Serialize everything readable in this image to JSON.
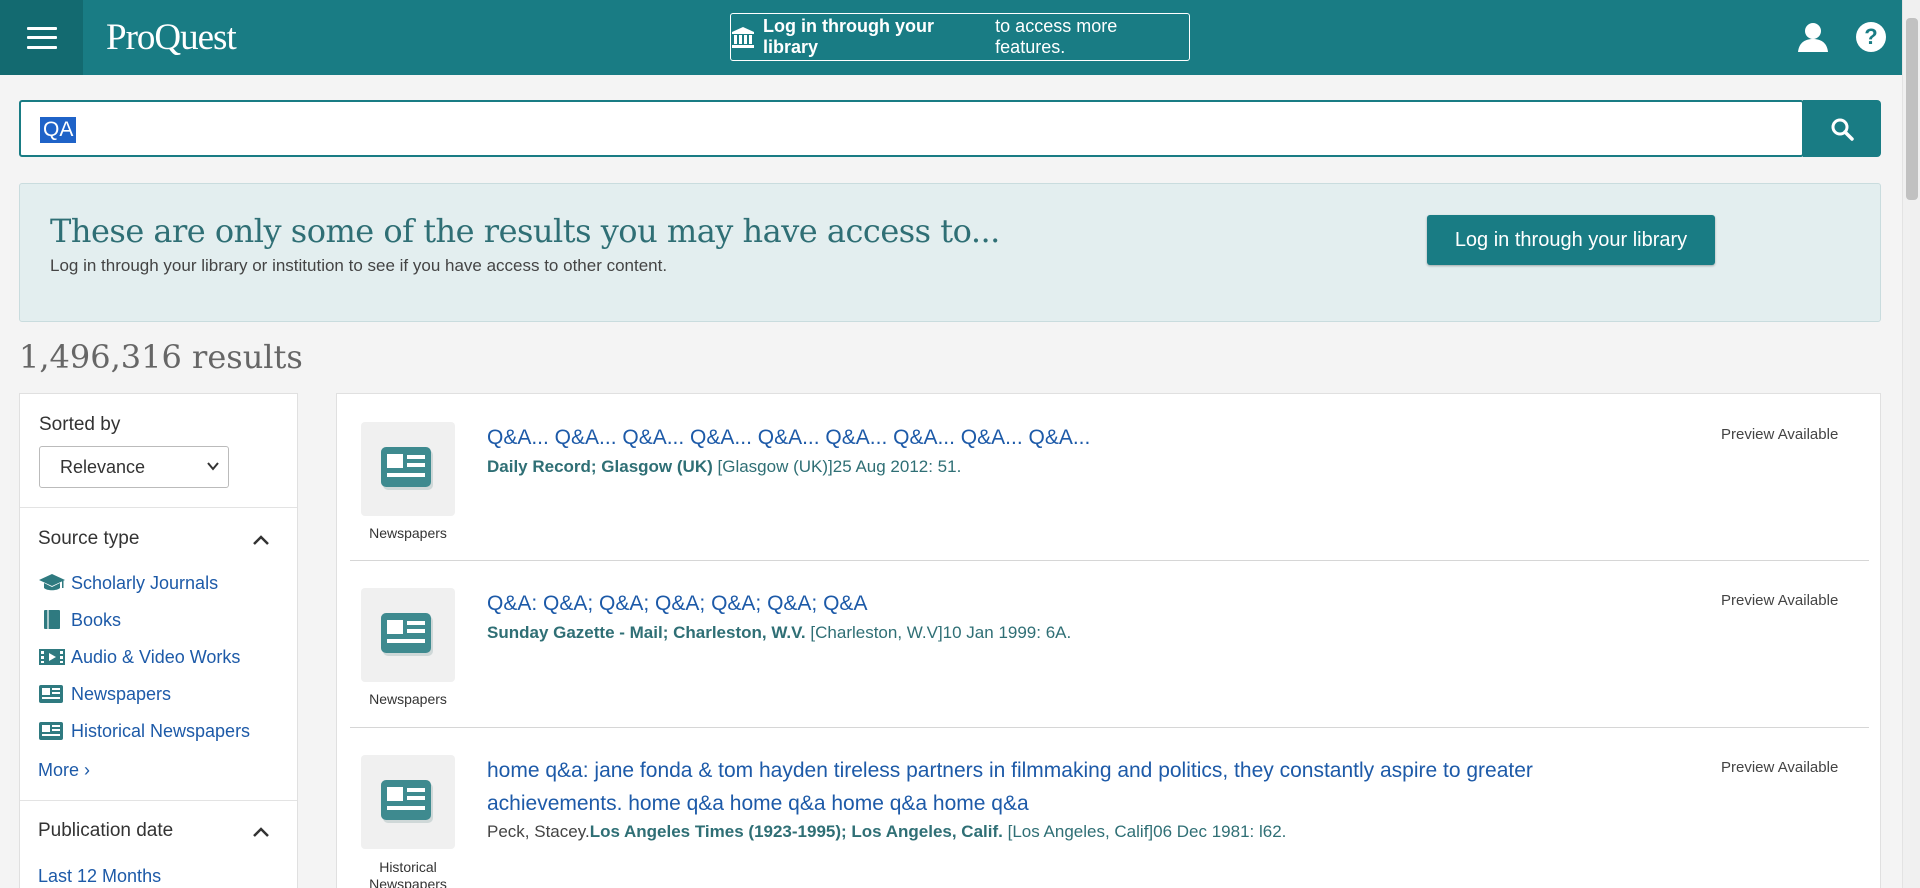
{
  "header": {
    "logo": "ProQuest",
    "login_bold": "Log in through your library",
    "login_rest": "to access more features.",
    "icons": [
      "menu-icon",
      "library-icon",
      "user-icon",
      "help-icon"
    ],
    "accent_color": "#197c84"
  },
  "search": {
    "value": "QA",
    "button_icon": "search-icon"
  },
  "notice": {
    "title": "These are only some of the results you may have access to...",
    "subtitle": "Log in through your library or institution to see if you have access to other content.",
    "button": "Log in through your library"
  },
  "results_count": "1,496,316 results",
  "sidebar": {
    "sort_label": "Sorted by",
    "sort_value": "Relevance",
    "source_type_title": "Source type",
    "source_types": [
      {
        "label": "Scholarly Journals",
        "icon": "graduation-cap-icon"
      },
      {
        "label": "Books",
        "icon": "book-icon"
      },
      {
        "label": "Audio & Video Works",
        "icon": "film-icon"
      },
      {
        "label": "Newspapers",
        "icon": "newspaper-icon"
      },
      {
        "label": "Historical Newspapers",
        "icon": "newspaper-icon"
      }
    ],
    "more": "More ›",
    "pub_date_title": "Publication date",
    "pub_date_first": "Last 12 Months"
  },
  "results": [
    {
      "type": "Newspapers",
      "title": "Q&A... Q&A... Q&A... Q&A... Q&A... Q&A... Q&A... Q&A... Q&A...",
      "source": "Daily Record; Glasgow (UK)",
      "detail": "[Glasgow (UK)]25 Aug 2012: 51.",
      "preview": "Preview Available"
    },
    {
      "type": "Newspapers",
      "title": "Q&A: Q&A; Q&A; Q&A; Q&A; Q&A; Q&A",
      "source": "Sunday Gazette - Mail; Charleston, W.V.",
      "detail": "[Charleston, W.V]10 Jan 1999: 6A.",
      "preview": "Preview Available"
    },
    {
      "type": "Historical Newspapers",
      "title_line1": "home q&a: jane fonda & tom hayden tireless partners in filmmaking and politics, they constantly aspire to greater",
      "title_line2": "achievements. home q&a home q&a home q&a home q&a",
      "author": "Peck, Stacey.",
      "source": "Los Angeles Times (1923-1995); Los Angeles, Calif.",
      "detail": "[Los Angeles, Calif]06 Dec 1981: l62.",
      "preview": "Preview Available"
    }
  ]
}
